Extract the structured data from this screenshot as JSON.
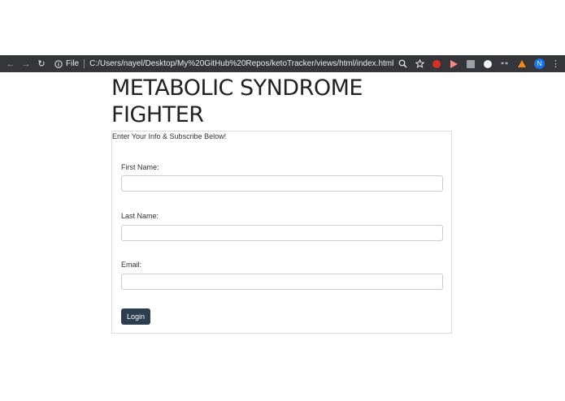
{
  "browser": {
    "back_icon": "←",
    "forward_icon": "→",
    "reload_icon": "↻",
    "scheme_label": "File",
    "url": "C:/Users/nayel/Desktop/My%20GitHub%20Repos/ketoTracker/views/html/index.html",
    "profile_initial": "N",
    "menu_icon": "⋮",
    "extension_glasses": "👓",
    "zoom_icon": "magnifier-icon",
    "bookmark_icon": "star-icon"
  },
  "page": {
    "title": "METABOLIC SYNDROME FIGHTER",
    "intro": "Enter Your Info & Subscribe Below!",
    "fields": [
      {
        "label": "First Name:",
        "value": ""
      },
      {
        "label": "Last Name:",
        "value": ""
      },
      {
        "label": "Email:",
        "value": ""
      }
    ],
    "login_label": "Login",
    "accent_color": "#2c3e50"
  }
}
